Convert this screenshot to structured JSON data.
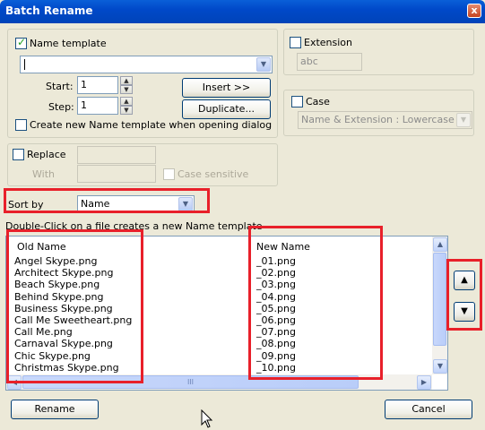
{
  "window": {
    "title": "Batch Rename",
    "close_glyph": "x"
  },
  "name_template": {
    "label": "Name template",
    "checked": true,
    "value": "",
    "start_label": "Start:",
    "start_value": "1",
    "step_label": "Step:",
    "step_value": "1",
    "insert_label": "Insert >>",
    "duplicate_label": "Duplicate...",
    "create_new_label": "Create new Name template when opening dialog"
  },
  "extension": {
    "label": "Extension",
    "value": "abc"
  },
  "case": {
    "label": "Case",
    "value": "Name & Extension : Lowercase"
  },
  "replace": {
    "label": "Replace",
    "with_label": "With",
    "case_sensitive_label": "Case sensitive"
  },
  "sort": {
    "label": "Sort by",
    "value": "Name"
  },
  "hint": "Double-Click on a file creates a new Name template",
  "file_list": {
    "columns": {
      "old": "Old Name",
      "new": "New Name"
    },
    "rows": [
      {
        "old": "Angel Skype.png",
        "new": "_01.png"
      },
      {
        "old": "Architect Skype.png",
        "new": "_02.png"
      },
      {
        "old": "Beach Skype.png",
        "new": "_03.png"
      },
      {
        "old": "Behind Skype.png",
        "new": "_04.png"
      },
      {
        "old": "Business Skype.png",
        "new": "_05.png"
      },
      {
        "old": "Call Me Sweetheart.png",
        "new": "_06.png"
      },
      {
        "old": "Call Me.png",
        "new": "_07.png"
      },
      {
        "old": "Carnaval Skype.png",
        "new": "_08.png"
      },
      {
        "old": "Chic Skype.png",
        "new": "_09.png"
      },
      {
        "old": "Christmas Skype.png",
        "new": "_10.png"
      }
    ],
    "hscroll_grip": "III"
  },
  "buttons": {
    "rename": "Rename",
    "cancel": "Cancel"
  },
  "colors": {
    "highlight": "#e8202a",
    "title_bar": "#0049c9"
  }
}
